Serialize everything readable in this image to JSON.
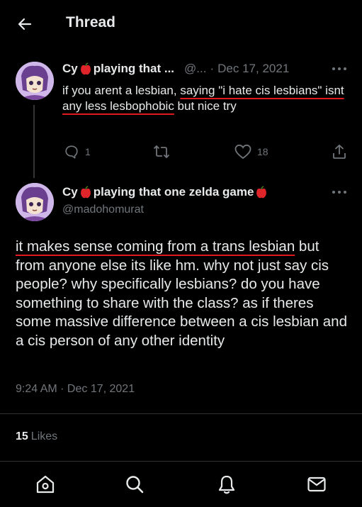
{
  "header": {
    "title": "Thread"
  },
  "parent_tweet": {
    "author_name": "Cy",
    "author_label_truncated": "playing that ...",
    "handle_truncated": "@...",
    "date": "Dec 17, 2021",
    "body_parts": [
      "if you arent a lesbian, ",
      "saying \"i hate cis lesbians\" isnt any less lesbophobic",
      " but nice try"
    ],
    "replies": "1",
    "retweets": "",
    "likes": "18"
  },
  "main_tweet": {
    "author_name": "Cy",
    "author_label": "playing that one zelda game",
    "handle": "@madohomurat",
    "body_parts": [
      "it makes sense coming from a trans lesbian",
      " but from anyone else its like hm. why not just say cis people? why specifically lesbians? do you have something to share with the class? as if theres some massive difference between a cis lesbian and a cis person of any other identity"
    ],
    "timestamp": "9:24 AM · Dec 17, 2021",
    "likes_count": "15",
    "likes_label": "Likes"
  },
  "colors": {
    "background": "#000000",
    "text": "#e7e9ea",
    "muted": "#71767b",
    "underline": "#e0191f",
    "apple": "#e0252a"
  },
  "icons": [
    "back-arrow-icon",
    "apple-emoji-icon",
    "more-icon",
    "reply-icon",
    "retweet-icon",
    "like-icon",
    "share-icon",
    "home-icon",
    "search-icon",
    "notifications-icon",
    "messages-icon"
  ]
}
